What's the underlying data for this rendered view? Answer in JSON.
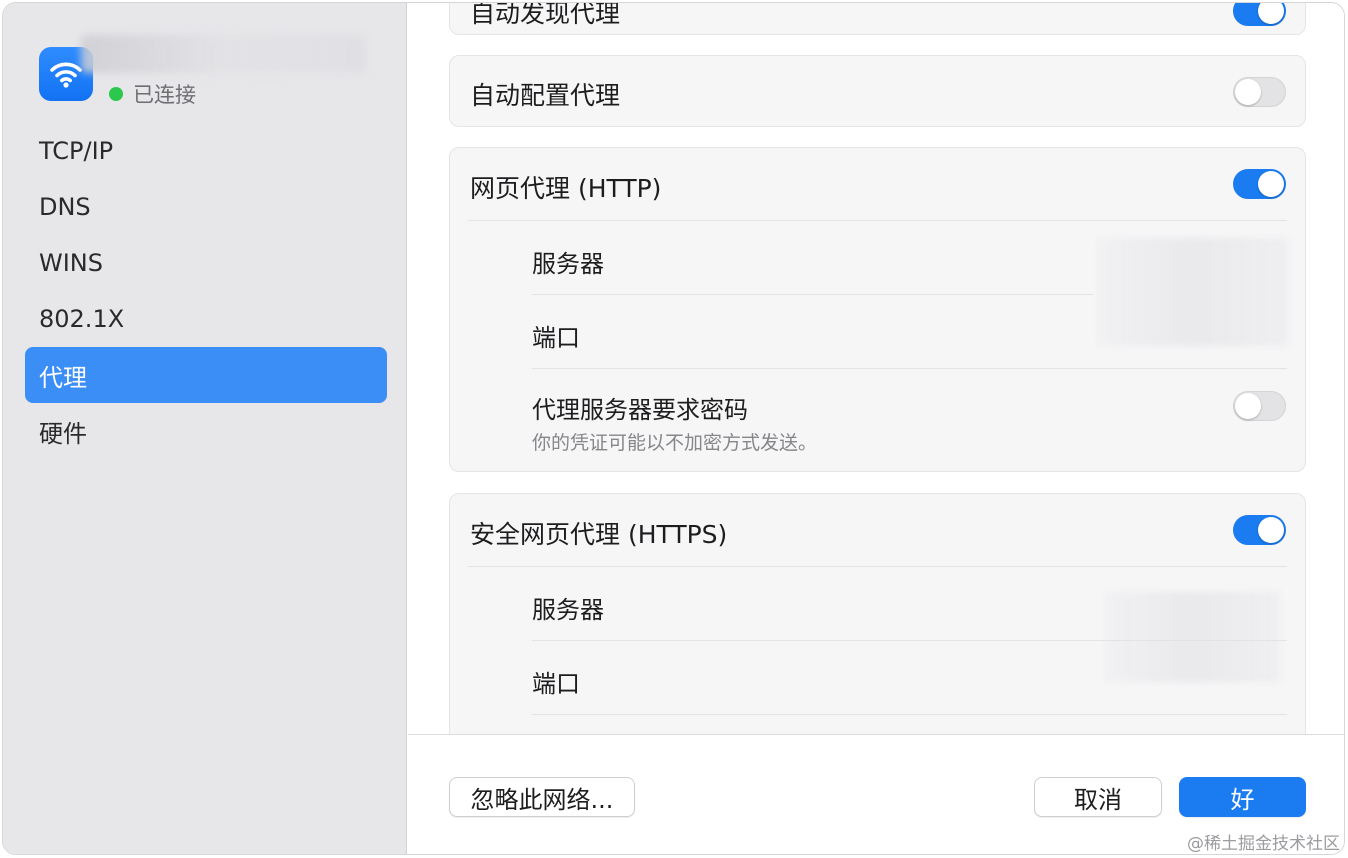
{
  "sidebar": {
    "status": "已连接",
    "items": [
      {
        "label": "TCP/IP"
      },
      {
        "label": "DNS"
      },
      {
        "label": "WINS"
      },
      {
        "label": "802.1X"
      },
      {
        "label": "代理"
      },
      {
        "label": "硬件"
      }
    ],
    "selected": "代理"
  },
  "main": {
    "top_partial": {
      "label": "自动发现代理",
      "enabled": true
    },
    "auto_config": {
      "label": "自动配置代理",
      "enabled": false
    },
    "http": {
      "label": "网页代理 (HTTP)",
      "enabled": true,
      "server_label": "服务器",
      "port_label": "端口",
      "password_label": "代理服务器要求密码",
      "password_desc": "你的凭证可能以不加密方式发送。",
      "password_enabled": false
    },
    "https": {
      "label": "安全网页代理 (HTTPS)",
      "enabled": true,
      "server_label": "服务器",
      "port_label": "端口"
    }
  },
  "footer": {
    "ignore_label": "忽略此网络...",
    "cancel_label": "取消",
    "ok_label": "好"
  },
  "watermark": "@稀土掘金技术社区",
  "colors": {
    "accent": "#1a7cf0",
    "connected": "#2cc84d",
    "sidebar_bg": "#e7e7ea"
  }
}
